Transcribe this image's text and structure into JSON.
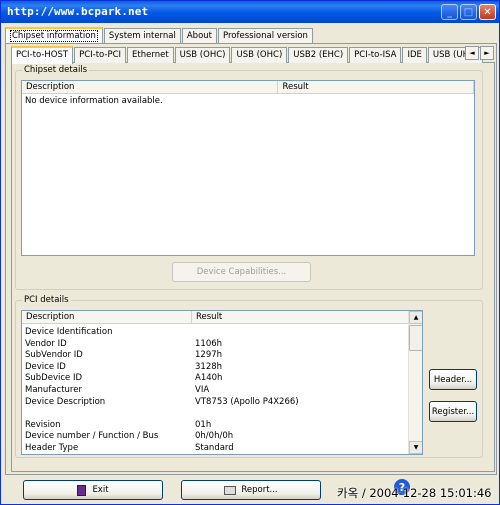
{
  "window": {
    "title": "http://www.bcpark.net"
  },
  "main_tabs": [
    "Chipset information",
    "System internal",
    "About",
    "Professional version"
  ],
  "sub_tabs": [
    "PCI-to-HOST",
    "PCI-to-PCI",
    "Ethernet",
    "USB (OHC)",
    "USB (OHC)",
    "USB2 (EHC)",
    "PCI-to-ISA",
    "IDE",
    "USB (UHC)"
  ],
  "tab_scroll": {
    "left": "◄",
    "right": "►"
  },
  "chipset_details": {
    "label": "Chipset details",
    "columns": [
      "Description",
      "Result"
    ],
    "rows": [
      [
        "No device information available.",
        ""
      ]
    ],
    "capabilities_button": "Device Capabilities..."
  },
  "pci_details": {
    "label": "PCI details",
    "columns": [
      "Description",
      "Result"
    ],
    "rows": [
      [
        "Device Identification",
        ""
      ],
      [
        "Vendor ID",
        "1106h"
      ],
      [
        "SubVendor ID",
        "1297h"
      ],
      [
        "Device ID",
        "3128h"
      ],
      [
        "SubDevice ID",
        "A140h"
      ],
      [
        "Manufacturer",
        "VIA"
      ],
      [
        "Device Description",
        "VT8753 (Apollo P4X266)"
      ],
      [
        "",
        ""
      ],
      [
        "Revision",
        "01h"
      ],
      [
        "Device number / Function / Bus",
        "0h/0h/0h"
      ],
      [
        "Header Type",
        "Standard"
      ]
    ],
    "header_button": "Header...",
    "register_button": "Register..."
  },
  "bottom": {
    "exit_label": "Exit",
    "report_label": "Report...",
    "watermark": "카옥 / 2004-12-28 15:01:46"
  }
}
